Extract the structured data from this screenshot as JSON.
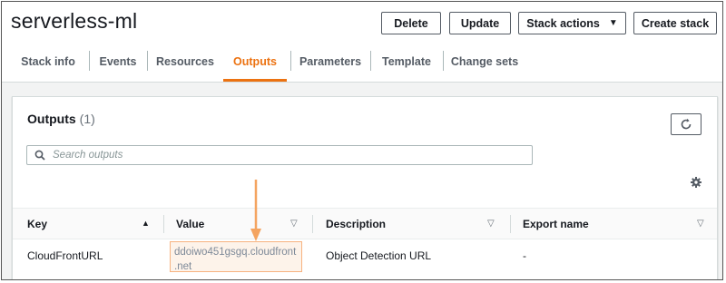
{
  "header": {
    "stack_name": "serverless-ml",
    "buttons": {
      "delete": "Delete",
      "update": "Update",
      "stack_actions": "Stack actions",
      "create_stack": "Create stack"
    }
  },
  "tabs": [
    {
      "label": "Stack info",
      "active": false
    },
    {
      "label": "Events",
      "active": false
    },
    {
      "label": "Resources",
      "active": false
    },
    {
      "label": "Outputs",
      "active": true
    },
    {
      "label": "Parameters",
      "active": false
    },
    {
      "label": "Template",
      "active": false
    },
    {
      "label": "Change sets",
      "active": false
    }
  ],
  "outputs": {
    "title": "Outputs",
    "count": "(1)",
    "search_placeholder": "Search outputs",
    "columns": [
      {
        "label": "Key",
        "sort": "ascending"
      },
      {
        "label": "Value",
        "sort": "none"
      },
      {
        "label": "Description",
        "sort": "none"
      },
      {
        "label": "Export name",
        "sort": "none"
      }
    ],
    "rows": [
      {
        "key": "CloudFrontURL",
        "value_line1": "ddoiwo451gsgq.cloudfront",
        "value_line2": ".net",
        "description": "Object Detection URL",
        "export_name": "-"
      }
    ]
  },
  "colors": {
    "accent": "#ec7211",
    "highlight_border": "#f7b380",
    "highlight_fill": "#fdf3ea"
  },
  "icons": {
    "refresh": "refresh-icon",
    "search": "search-icon",
    "settings": "gear-icon",
    "annotation": "arrow-down-icon"
  }
}
